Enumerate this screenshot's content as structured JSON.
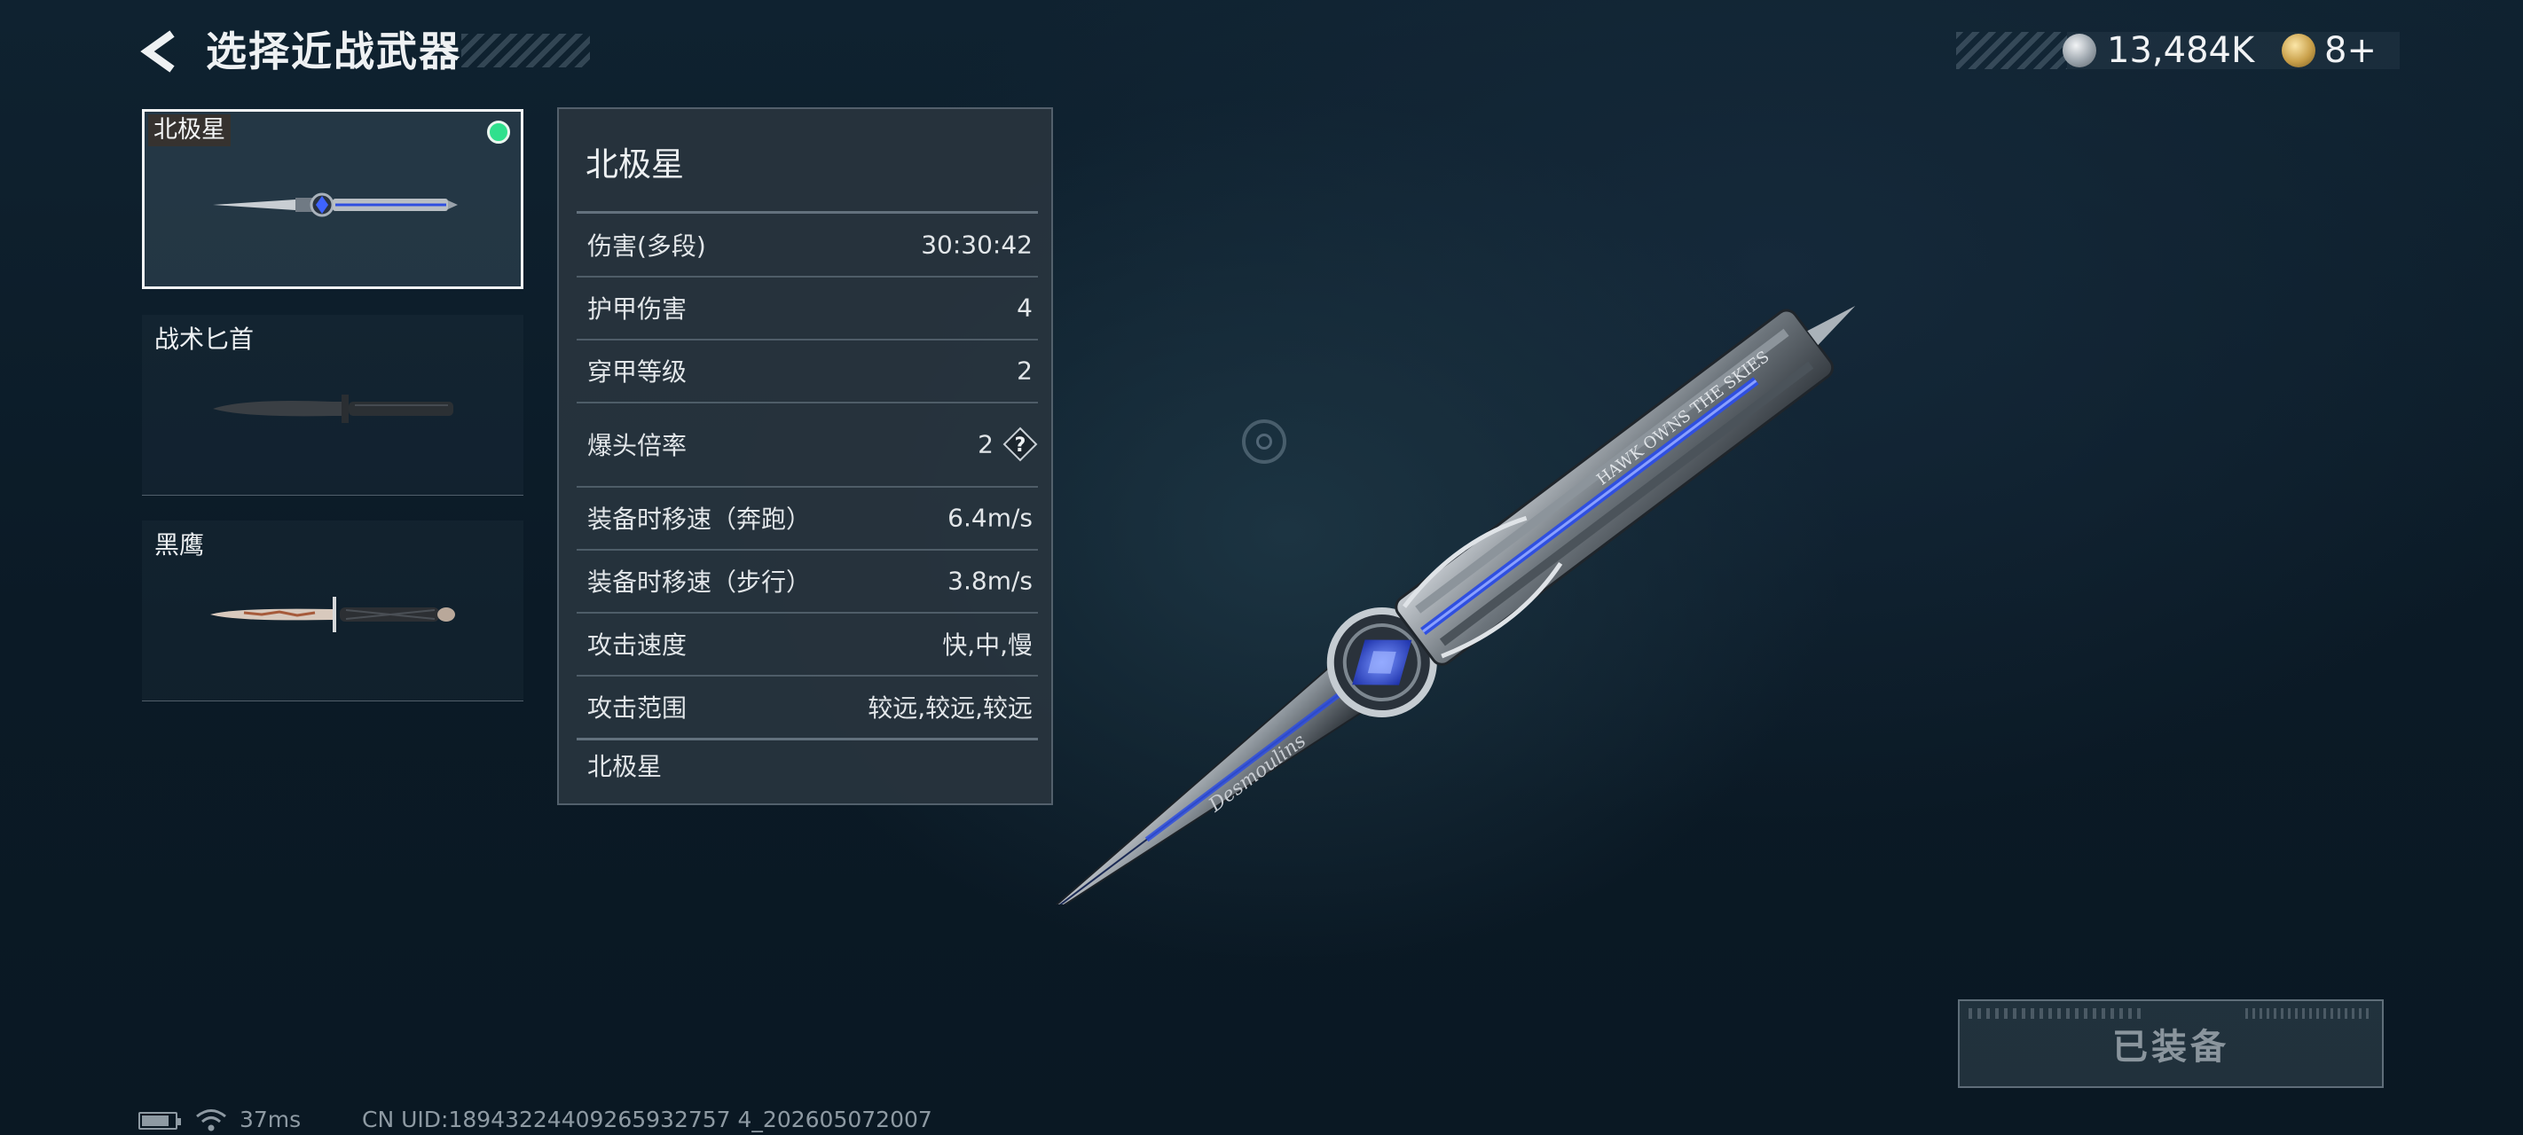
{
  "header": {
    "back_icon": "chevron-left-icon",
    "title": "选择近战武器"
  },
  "currency": {
    "coin_icon": "silver-coin-icon",
    "coin_value": "13,484K",
    "gold_icon": "gold-coin-icon",
    "gold_value": "8+"
  },
  "weapons": [
    {
      "name": "北极星",
      "selected": true,
      "equipped": true
    },
    {
      "name": "战术匕首",
      "selected": false,
      "equipped": false
    },
    {
      "name": "黑鹰",
      "selected": false,
      "equipped": false
    }
  ],
  "stats_panel": {
    "title": "北极星",
    "rows": [
      {
        "label": "伤害(多段)",
        "value": "30:30:42"
      },
      {
        "label": "护甲伤害",
        "value": "4"
      },
      {
        "label": "穿甲等级",
        "value": "2"
      },
      {
        "label": "爆头倍率",
        "value": "2",
        "help_icon": "question-diamond-icon"
      },
      {
        "label": "装备时移速（奔跑）",
        "value": "6.4m/s"
      },
      {
        "label": "装备时移速（步行）",
        "value": "3.8m/s"
      },
      {
        "label": "攻击速度",
        "value": "快,中,慢"
      },
      {
        "label": "攻击范围",
        "value": "较远,较远,较远"
      }
    ],
    "footer": "北极星"
  },
  "knife_engravings": {
    "blade": "Desmoulins",
    "handle": "HAWK OWNS THE SKIES"
  },
  "equip_button": {
    "label": "已装备"
  },
  "status_bar": {
    "ping": "37ms",
    "uid": "CN UID:18943224409265932757 4_202605072007"
  },
  "colors": {
    "background": "#0d1e2a",
    "equipped_dot": "#2fe08d",
    "blade_accent": "#2f4fe0"
  }
}
